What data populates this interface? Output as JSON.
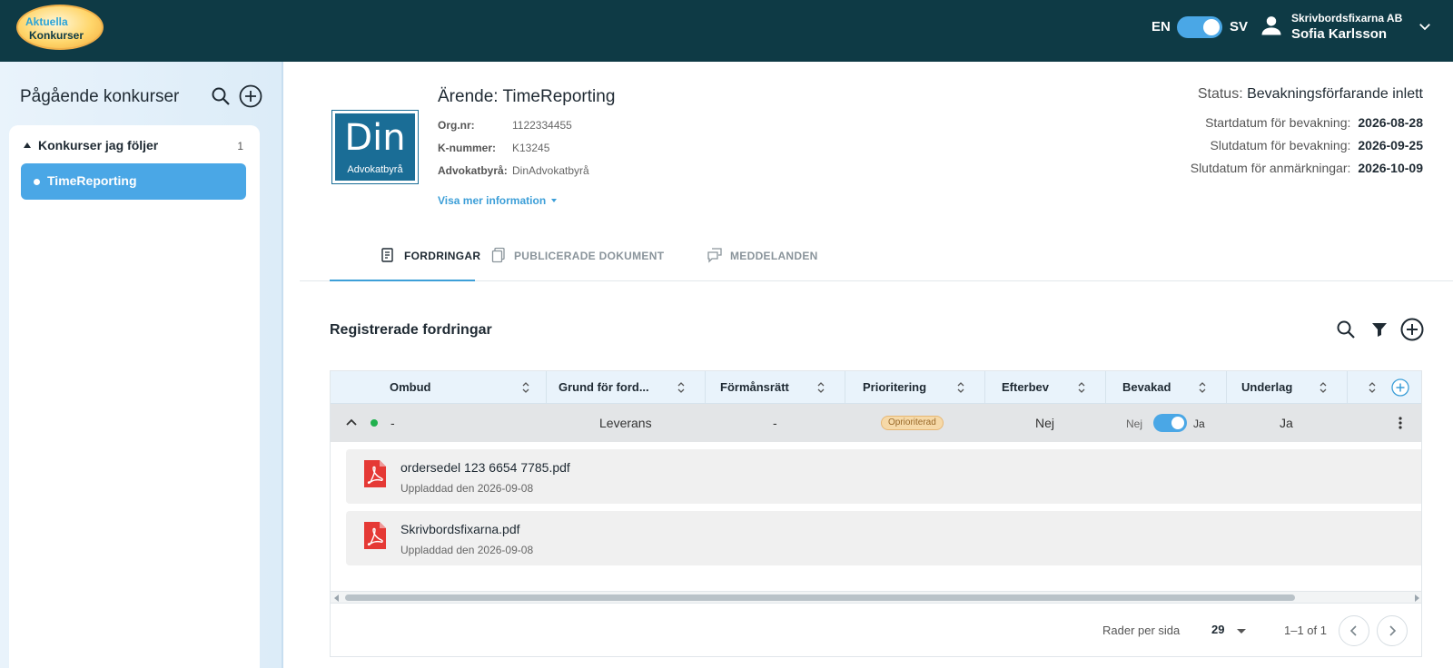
{
  "header": {
    "logo_line1": "Aktuella",
    "logo_line2": "Konkurser",
    "lang_left": "EN",
    "lang_right": "SV",
    "lang_toggle_on": true,
    "org": "Skrivbordsfixarna AB",
    "user": "Sofia Karlsson",
    "colors": {
      "bar": "#0e3a45",
      "accent": "#4aa7e6"
    }
  },
  "sidebar": {
    "title": "Pågående konkurser",
    "group_label": "Konkurser jag följer",
    "group_count": "1",
    "items": [
      {
        "label": "TimeReporting",
        "selected": true
      }
    ]
  },
  "case": {
    "logo_big": "Din",
    "logo_small": "Advokatbyrå",
    "title": "Ärende: TimeReporting",
    "fields": [
      {
        "label": "Org.nr:",
        "value": "1122334455"
      },
      {
        "label": "K-nummer:",
        "value": "K13245"
      },
      {
        "label": "Advokatbyrå:",
        "value": "DinAdvokatbyrå"
      }
    ],
    "more_link": "Visa mer information",
    "status_label": "Status:",
    "status_value": "Bevakningsförfarande inlett",
    "dates": [
      {
        "label": "Startdatum för bevakning:",
        "value": "2026-08-28"
      },
      {
        "label": "Slutdatum för bevakning:",
        "value": "2026-09-25"
      },
      {
        "label": "Slutdatum för anmärkningar:",
        "value": "2026-10-09"
      }
    ]
  },
  "tabs": [
    {
      "label": "FORDRINGAR",
      "icon": "document-list-icon",
      "active": true
    },
    {
      "label": "PUBLICERADE DOKUMENT",
      "icon": "documents-icon",
      "active": false
    },
    {
      "label": "MEDDELANDEN",
      "icon": "messages-icon",
      "active": false
    }
  ],
  "section": {
    "title": "Registrerade fordringar"
  },
  "table": {
    "columns": [
      "Ombud",
      "Grund för ford...",
      "Förmånsrätt",
      "Prioritering",
      "Efterbev",
      "Bevakad",
      "Underlag",
      ""
    ],
    "row": {
      "ombud": "-",
      "grund": "Leverans",
      "formansratt": "-",
      "prioritering": "Oprioriterad",
      "efterbev": "Nej",
      "bevakad_off": "Nej",
      "bevakad_on": "Ja",
      "underlag": "Ja",
      "status_color": "#21b14e"
    },
    "files": [
      {
        "name": "ordersedel 123 6654 7785.pdf",
        "uploaded": "Uppladdad den 2026-09-08"
      },
      {
        "name": "Skrivbordsfixarna.pdf",
        "uploaded": "Uppladdad den 2026-09-08"
      }
    ]
  },
  "pager": {
    "rows_label": "Rader per sida",
    "rows_value": "29",
    "range": "1–1 of 1"
  }
}
